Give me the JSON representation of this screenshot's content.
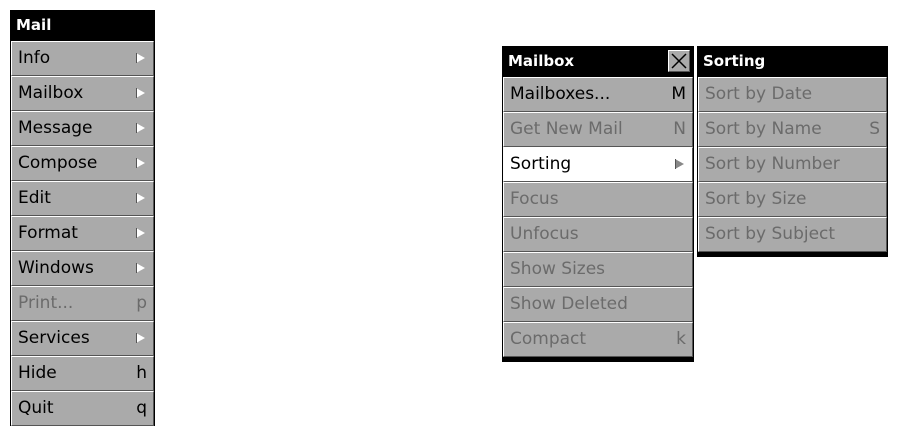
{
  "main_menu": {
    "title": "Mail",
    "items": [
      {
        "label": "Info",
        "key": "",
        "submenu": true,
        "enabled": true
      },
      {
        "label": "Mailbox",
        "key": "",
        "submenu": true,
        "enabled": true
      },
      {
        "label": "Message",
        "key": "",
        "submenu": true,
        "enabled": true
      },
      {
        "label": "Compose",
        "key": "",
        "submenu": true,
        "enabled": true
      },
      {
        "label": "Edit",
        "key": "",
        "submenu": true,
        "enabled": true
      },
      {
        "label": "Format",
        "key": "",
        "submenu": true,
        "enabled": true
      },
      {
        "label": "Windows",
        "key": "",
        "submenu": true,
        "enabled": true
      },
      {
        "label": "Print...",
        "key": "p",
        "submenu": false,
        "enabled": false
      },
      {
        "label": "Services",
        "key": "",
        "submenu": true,
        "enabled": true
      },
      {
        "label": "Hide",
        "key": "h",
        "submenu": false,
        "enabled": true
      },
      {
        "label": "Quit",
        "key": "q",
        "submenu": false,
        "enabled": true
      }
    ]
  },
  "mailbox_menu": {
    "title": "Mailbox",
    "close_icon": "close-x-icon",
    "items": [
      {
        "label": "Mailboxes...",
        "key": "M",
        "enabled": true
      },
      {
        "label": "Get New Mail",
        "key": "N",
        "enabled": false
      },
      {
        "label": "Sorting",
        "key": "",
        "submenu": true,
        "enabled": true,
        "selected": true
      },
      {
        "label": "Focus",
        "key": "",
        "enabled": false
      },
      {
        "label": "Unfocus",
        "key": "",
        "enabled": false
      },
      {
        "label": "Show Sizes",
        "key": "",
        "enabled": false
      },
      {
        "label": "Show Deleted",
        "key": "",
        "enabled": false
      },
      {
        "label": "Compact",
        "key": "k",
        "enabled": false
      }
    ]
  },
  "sorting_menu": {
    "title": "Sorting",
    "items": [
      {
        "label": "Sort by Date",
        "key": "",
        "enabled": false
      },
      {
        "label": "Sort by Name",
        "key": "S",
        "enabled": false
      },
      {
        "label": "Sort by Number",
        "key": "",
        "enabled": false
      },
      {
        "label": "Sort by Size",
        "key": "",
        "enabled": false
      },
      {
        "label": "Sort by Subject",
        "key": "",
        "enabled": false
      }
    ]
  },
  "colors": {
    "title_bar": "#000000",
    "item_bg": "#aaaaaa",
    "selected_bg": "#ffffff",
    "disabled_text": "#6b6b6b"
  }
}
